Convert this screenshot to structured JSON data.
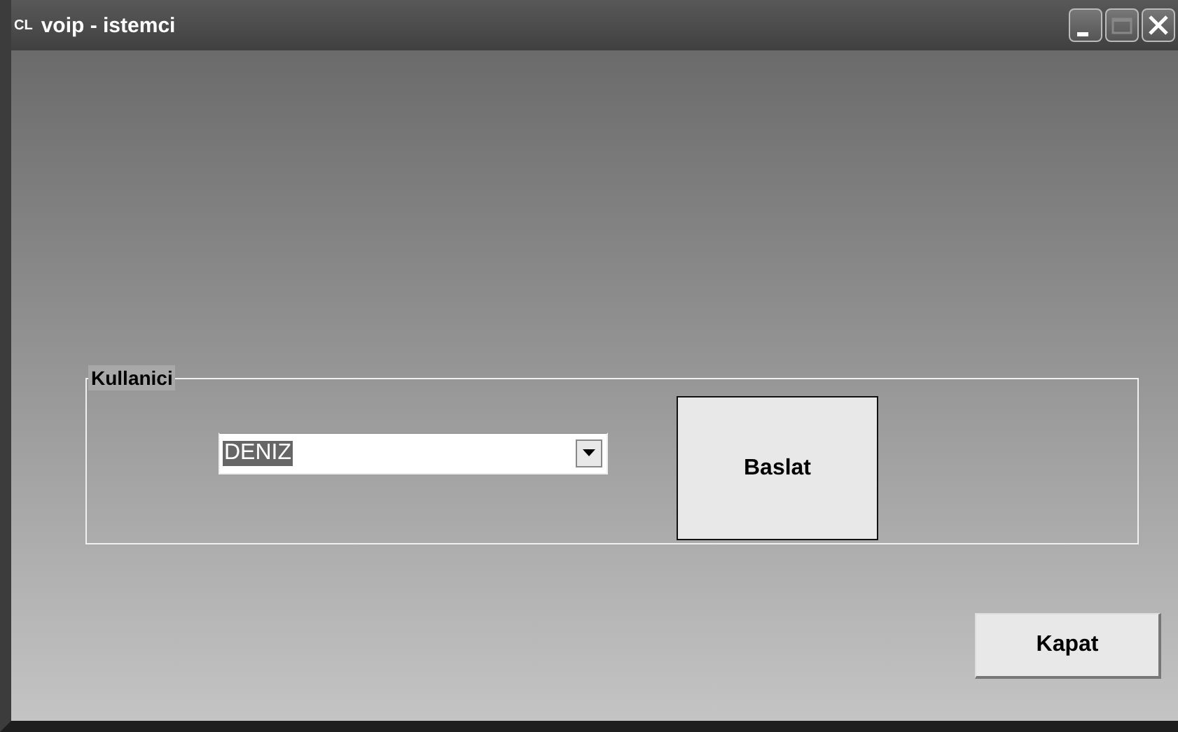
{
  "window": {
    "title": "voip - istemci",
    "app_icon_text": "CL"
  },
  "group": {
    "label": "Kullanici",
    "combo": {
      "value": "DENIZ",
      "highlighted": true
    },
    "start_button": "Baslat"
  },
  "close_button": "Kapat"
}
